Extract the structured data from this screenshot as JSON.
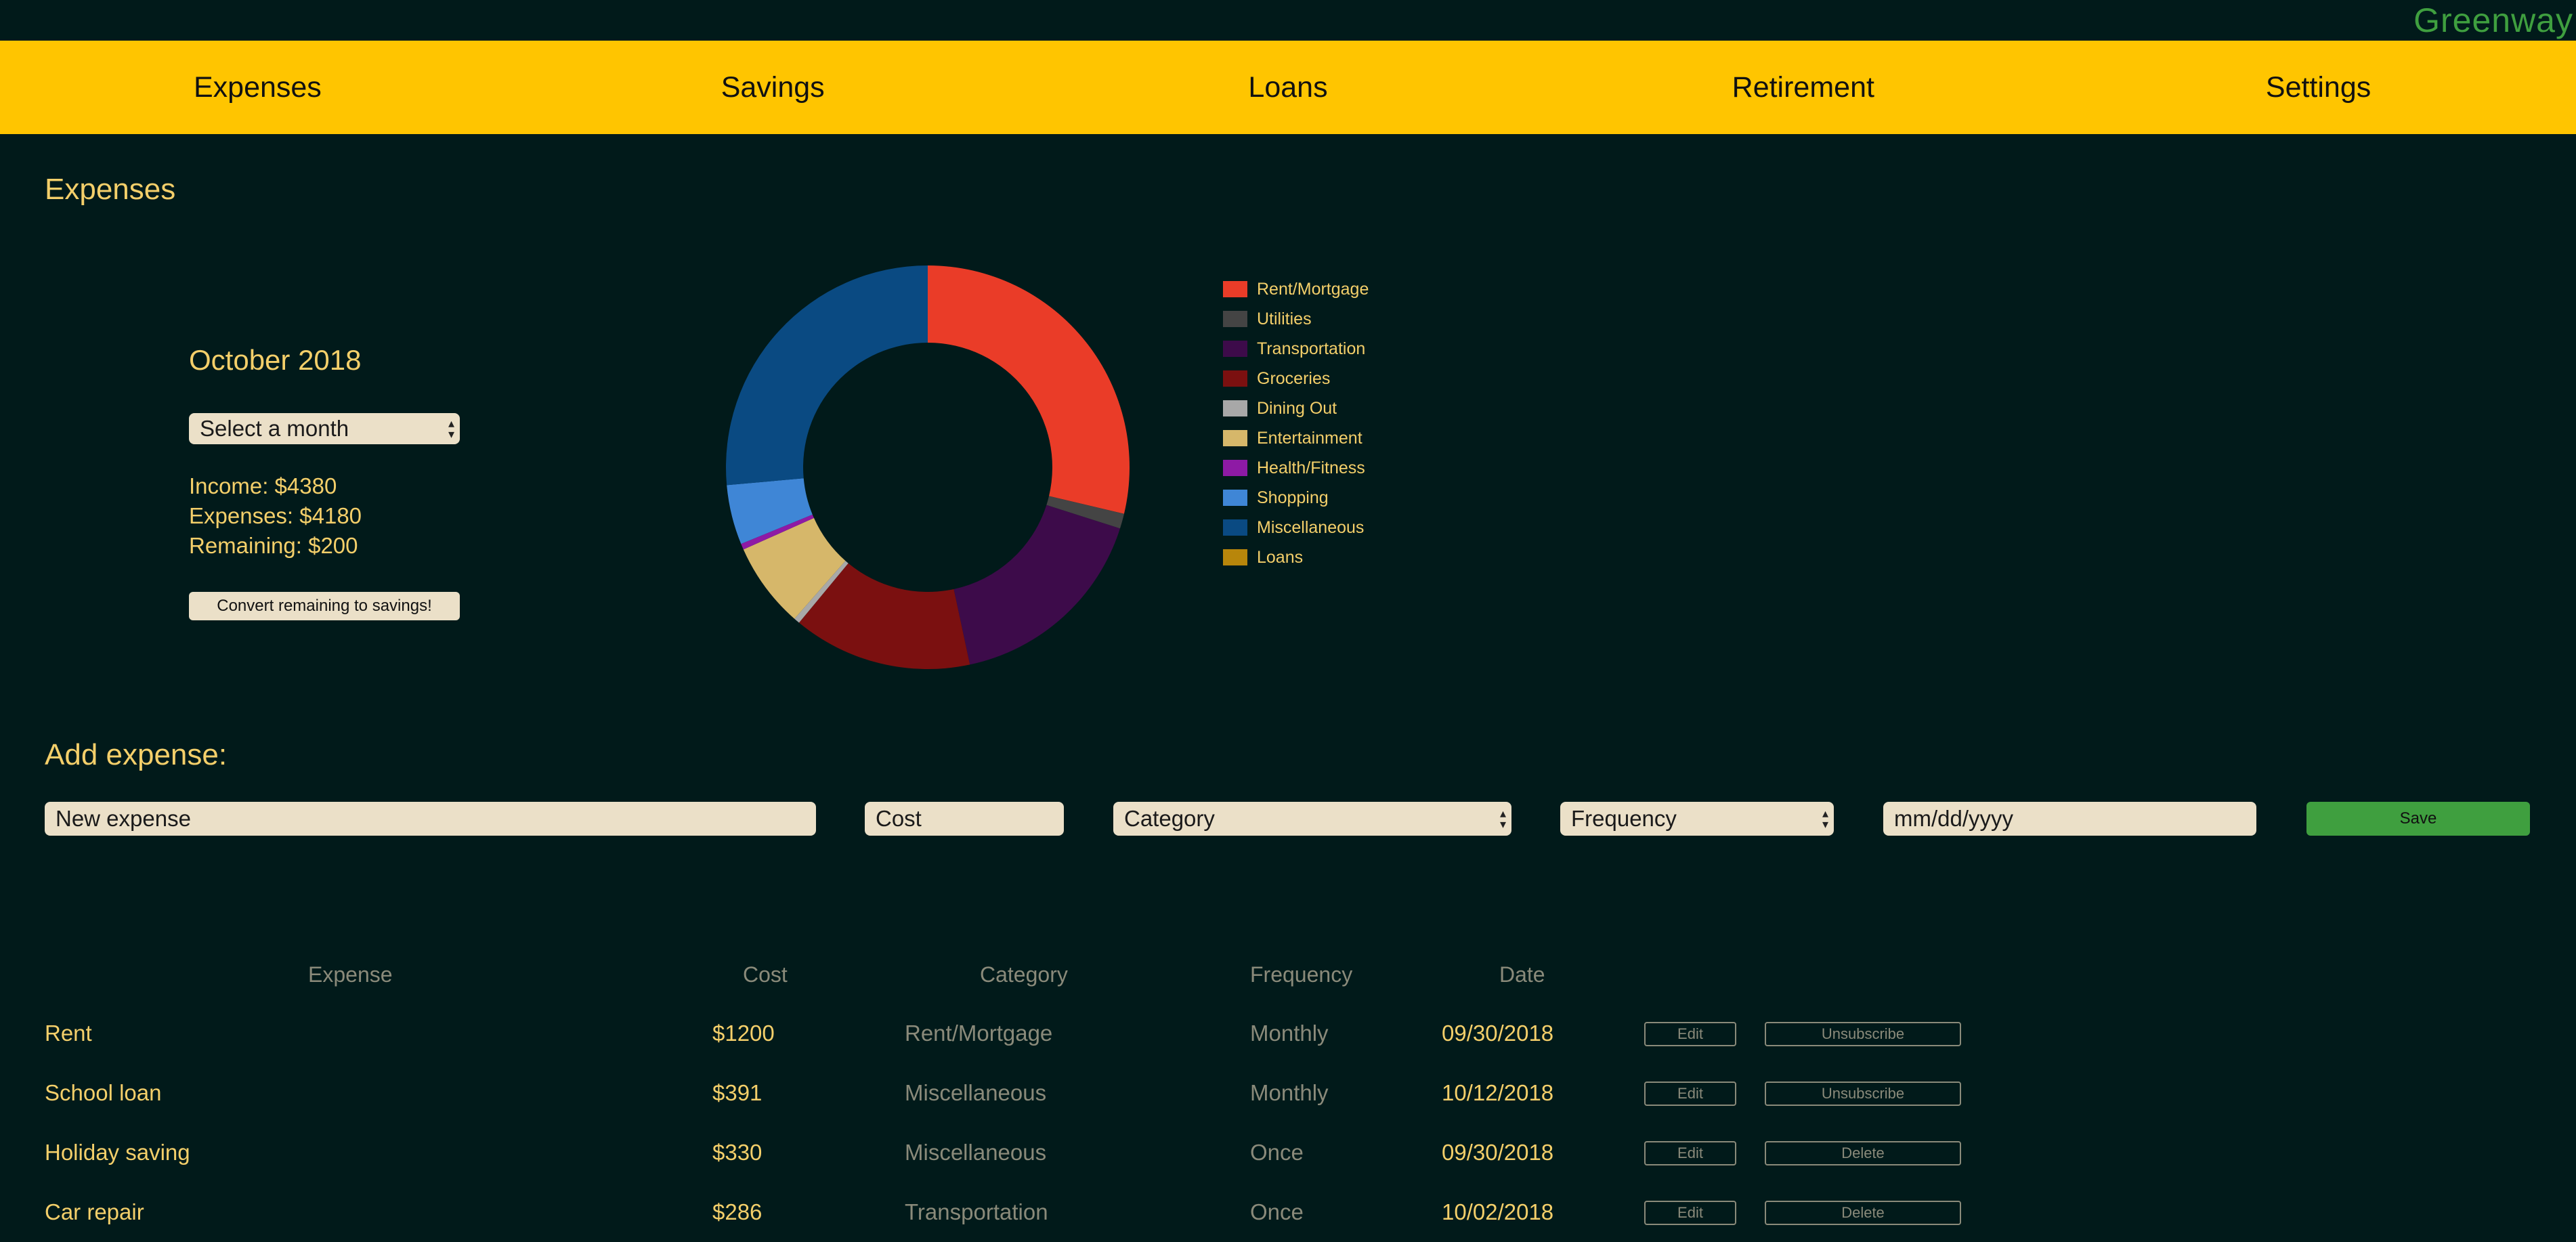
{
  "brand": {
    "name": "Greenway",
    "color": "#3f9f3f"
  },
  "nav": {
    "items": [
      {
        "label": "Expenses"
      },
      {
        "label": "Savings"
      },
      {
        "label": "Loans"
      },
      {
        "label": "Retirement"
      },
      {
        "label": "Settings"
      }
    ],
    "background": "#ffc500"
  },
  "page": {
    "title": "Expenses"
  },
  "summary": {
    "month_title": "October 2018",
    "month_select_value": "Select a month",
    "income": "Income: $4380",
    "expenses": "Expenses: $4180",
    "remaining": "Remaining: $200",
    "convert_label": "Convert remaining to savings!"
  },
  "chart_data": {
    "type": "pie",
    "categories": [
      "Rent/Mortgage",
      "Utilities",
      "Transportation",
      "Groceries",
      "Dining Out",
      "Entertainment",
      "Health/Fitness",
      "Shopping",
      "Miscellaneous",
      "Loans"
    ],
    "colors": [
      "#ea3c28",
      "#444444",
      "#3d0b4a",
      "#7b1010",
      "#a8a8a8",
      "#d6b76a",
      "#8e1aa5",
      "#3f86d6",
      "#0a4a82",
      "#b8860b"
    ],
    "values": [
      1200,
      50,
      700,
      600,
      20,
      286,
      20,
      200,
      1104,
      0
    ],
    "donut": true
  },
  "add_expense": {
    "title": "Add expense:",
    "name_placeholder": "New expense",
    "cost_placeholder": "Cost",
    "category_value": "Category",
    "frequency_value": "Frequency",
    "date_placeholder": "mm/dd/yyyy",
    "save_label": "Save"
  },
  "table": {
    "headers": {
      "expense": "Expense",
      "cost": "Cost",
      "category": "Category",
      "frequency": "Frequency",
      "date": "Date"
    },
    "rows": [
      {
        "expense": "Rent",
        "cost": "$1200",
        "category": "Rent/Mortgage",
        "frequency": "Monthly",
        "date": "09/30/2018",
        "edit": "Edit",
        "action": "Unsubscribe"
      },
      {
        "expense": "School loan",
        "cost": "$391",
        "category": "Miscellaneous",
        "frequency": "Monthly",
        "date": "10/12/2018",
        "edit": "Edit",
        "action": "Unsubscribe"
      },
      {
        "expense": "Holiday saving",
        "cost": "$330",
        "category": "Miscellaneous",
        "frequency": "Once",
        "date": "09/30/2018",
        "edit": "Edit",
        "action": "Delete"
      },
      {
        "expense": "Car repair",
        "cost": "$286",
        "category": "Transportation",
        "frequency": "Once",
        "date": "10/02/2018",
        "edit": "Edit",
        "action": "Delete"
      }
    ]
  }
}
